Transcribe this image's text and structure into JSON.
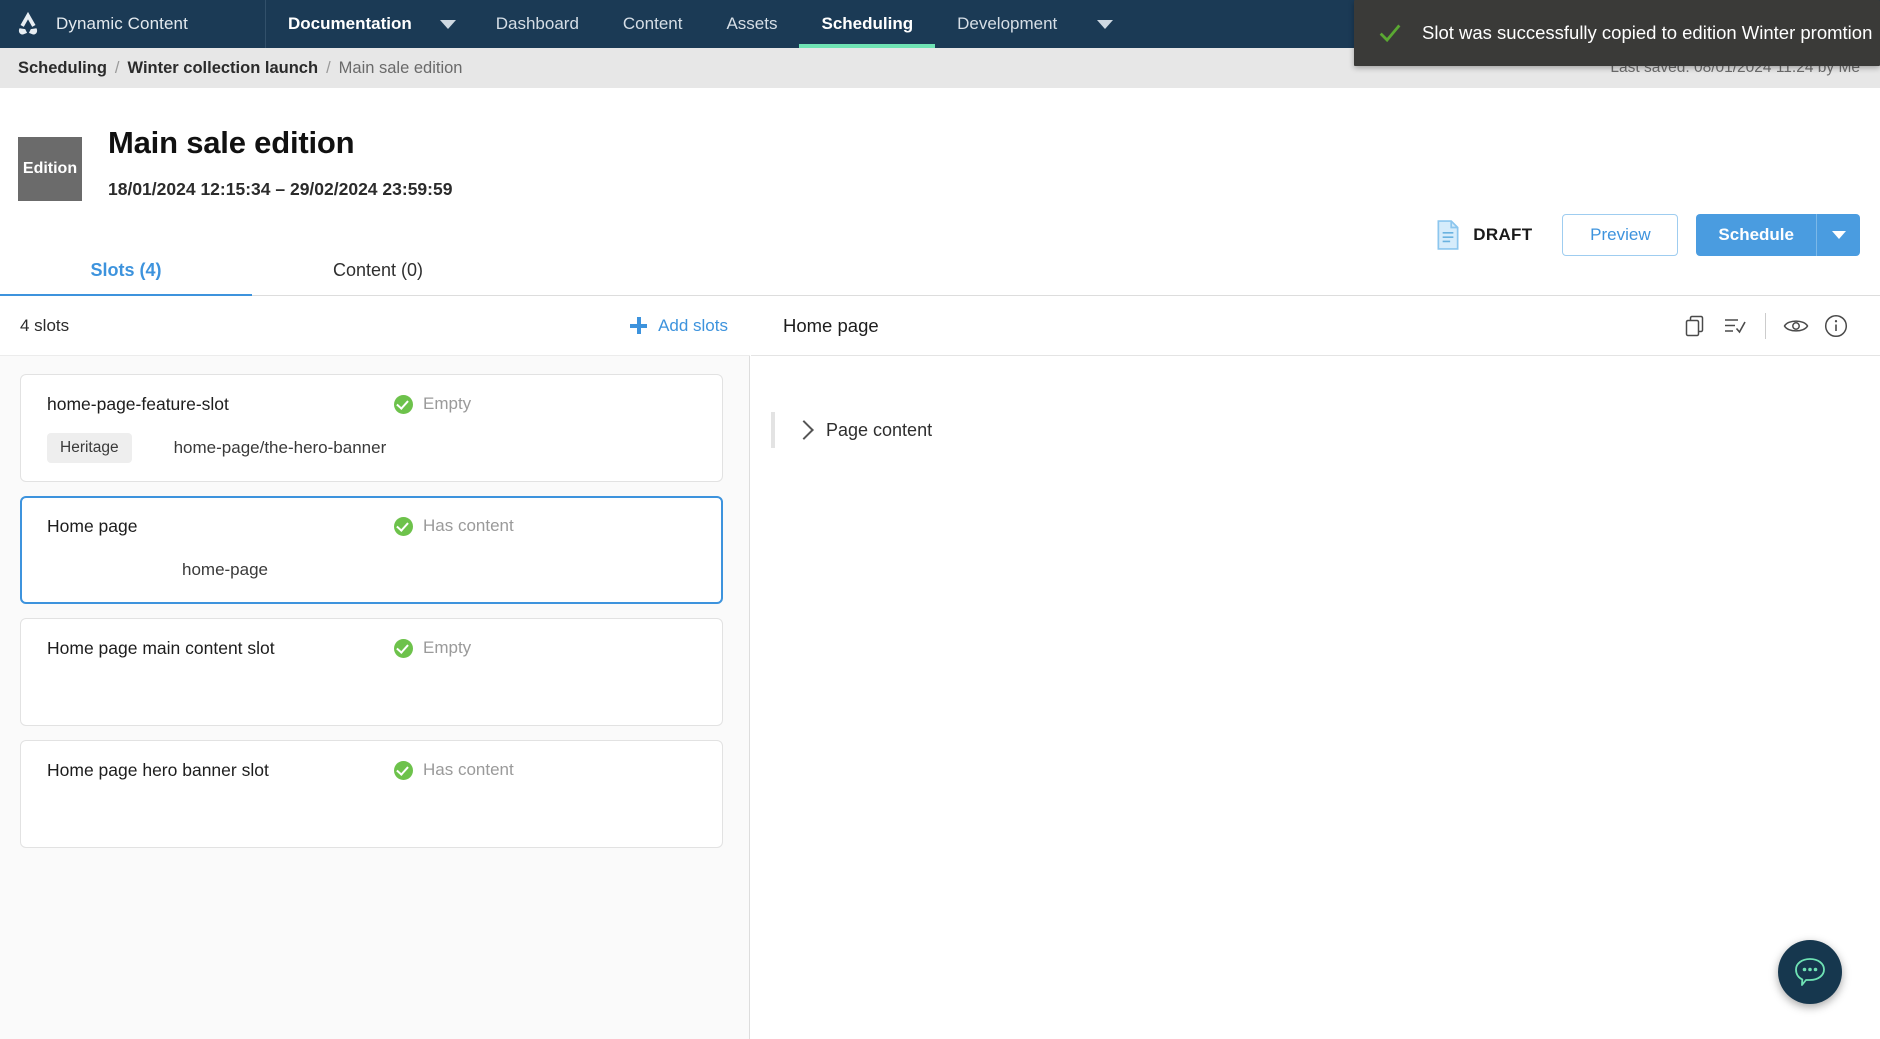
{
  "topnav": {
    "logo_name": "amplience-logo-icon",
    "brand": "Dynamic Content",
    "items": [
      {
        "label": "Documentation",
        "kind": "strong",
        "has_caret": true
      },
      {
        "label": "Dashboard",
        "kind": "normal",
        "has_caret": false
      },
      {
        "label": "Content",
        "kind": "normal",
        "has_caret": false
      },
      {
        "label": "Assets",
        "kind": "normal",
        "has_caret": false
      },
      {
        "label": "Scheduling",
        "kind": "active",
        "has_caret": false
      },
      {
        "label": "Development",
        "kind": "normal",
        "has_caret": true
      }
    ]
  },
  "toast": {
    "message": "Slot was successfully copied to edition Winter promtion",
    "icon": "check-icon",
    "icon_color": "#5aa832",
    "background": "#3a3a38"
  },
  "breadcrumb": {
    "items": [
      "Scheduling",
      "Winter collection launch",
      "Main sale edition"
    ],
    "separator": "/",
    "last_saved": "Last saved: 08/01/2024 11:24 by Me"
  },
  "header": {
    "badge_label": "Edition",
    "title": "Main sale edition",
    "dates": "18/01/2024 12:15:34  –  29/02/2024 23:59:59",
    "status_label": "DRAFT",
    "status_icon": "document-draft-icon",
    "preview_label": "Preview",
    "schedule_label": "Schedule",
    "schedule_caret_icon": "chevron-down-icon",
    "accent_color": "#4a9ce0"
  },
  "tabs": [
    {
      "label": "Slots (4)",
      "active": true
    },
    {
      "label": "Content (0)",
      "active": false
    }
  ],
  "left_pane": {
    "count_label": "4 slots",
    "add_label": "Add slots",
    "add_icon": "plus-icon",
    "slots": [
      {
        "name": "home-page-feature-slot",
        "status": "Empty",
        "status_icon": "check-circle-icon",
        "chip": "Heritage",
        "path": "home-page/the-hero-banner",
        "selected": false
      },
      {
        "name": "Home page",
        "status": "Has content",
        "status_icon": "check-circle-icon",
        "chip": "",
        "path": "home-page",
        "selected": true
      },
      {
        "name": "Home page main content slot",
        "status": "Empty",
        "status_icon": "check-circle-icon",
        "chip": "",
        "path": "",
        "selected": false
      },
      {
        "name": "Home page hero banner slot",
        "status": "Has content",
        "status_icon": "check-circle-icon",
        "chip": "",
        "path": "",
        "selected": false
      }
    ]
  },
  "right_pane": {
    "title": "Home page",
    "icons": [
      {
        "name": "copy-icon"
      },
      {
        "name": "list-check-icon"
      },
      {
        "name": "eye-icon"
      },
      {
        "name": "info-icon"
      }
    ],
    "tree": [
      {
        "label": "Page content",
        "expand_icon": "chevron-right-icon"
      }
    ]
  },
  "chat_fab": {
    "icon": "chat-bubble-icon",
    "background": "#16374e",
    "icon_color": "#6fe3b4"
  }
}
